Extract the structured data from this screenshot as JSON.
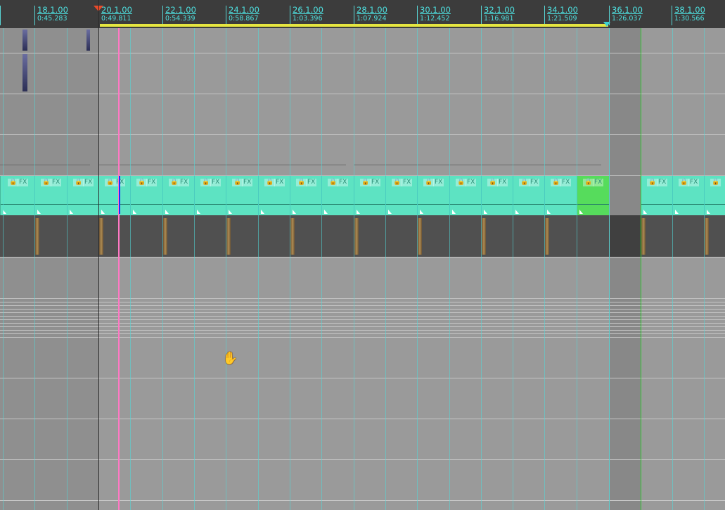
{
  "ruler": {
    "markers": [
      {
        "label": "18.1.00",
        "time": "0:45.283"
      },
      {
        "label": "20.1.00",
        "time": "0:49.811"
      },
      {
        "label": "22.1.00",
        "time": "0:54.339"
      },
      {
        "label": "24.1.00",
        "time": "0:58.867"
      },
      {
        "label": "26.1.00",
        "time": "1:03.396"
      },
      {
        "label": "28.1.00",
        "time": "1:07.924"
      },
      {
        "label": "30.1.00",
        "time": "1:12.452"
      },
      {
        "label": "32.1.00",
        "time": "1:16.981"
      },
      {
        "label": "34.1.00",
        "time": "1:21.509"
      },
      {
        "label": "36.1.00",
        "time": "1:26.037"
      },
      {
        "label": "38.1.00",
        "time": "1:30.566"
      }
    ]
  },
  "clip_icons": {
    "lock": "lock-icon",
    "fx": "FX"
  },
  "colors": {
    "ruler_bg": "#3c3c3c",
    "marker_text": "#4ee0e0",
    "clip_fill": "#5de3c2",
    "clip_selected": "#56dc5c",
    "playhead": "#ff78c4",
    "loop_bar": "#e6e640",
    "end_marker": "#2ecc2e"
  },
  "cursor": "hand-icon"
}
